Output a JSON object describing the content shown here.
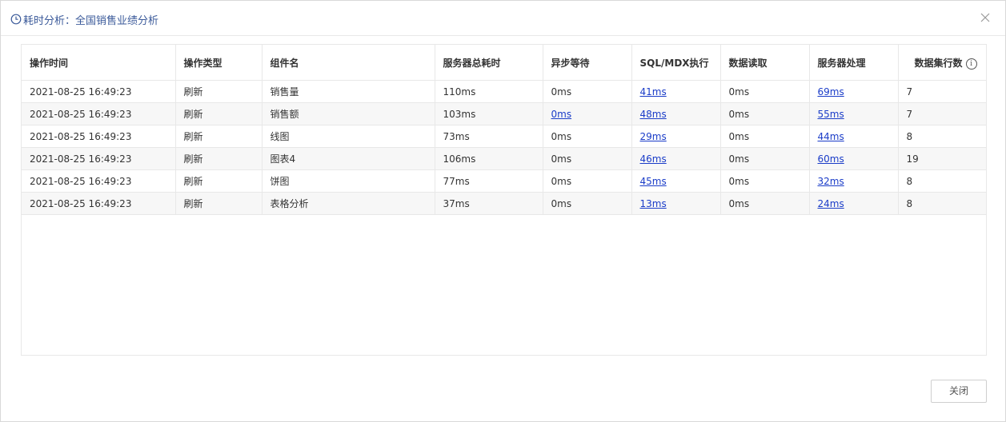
{
  "dialog": {
    "title": "耗时分析：全国销售业绩分析",
    "close_button_label": "关闭"
  },
  "table": {
    "columns": [
      "操作时间",
      "操作类型",
      "组件名",
      "服务器总耗时",
      "异步等待",
      "SQL/MDX执行",
      "数据读取",
      "服务器处理",
      "数据集行数"
    ],
    "rows": [
      {
        "time": "2021-08-25 16:49:23",
        "op": "刷新",
        "component": "销售量",
        "total": "110ms",
        "async": "0ms",
        "sql": "41ms",
        "read": "0ms",
        "server": "69ms",
        "rowcount": "7"
      },
      {
        "time": "2021-08-25 16:49:23",
        "op": "刷新",
        "component": "销售额",
        "total": "103ms",
        "async": "0ms",
        "sql": "48ms",
        "read": "0ms",
        "server": "55ms",
        "rowcount": "7"
      },
      {
        "time": "2021-08-25 16:49:23",
        "op": "刷新",
        "component": "线图",
        "total": "73ms",
        "async": "0ms",
        "sql": "29ms",
        "read": "0ms",
        "server": "44ms",
        "rowcount": "8"
      },
      {
        "time": "2021-08-25 16:49:23",
        "op": "刷新",
        "component": "图表4",
        "total": "106ms",
        "async": "0ms",
        "sql": "46ms",
        "read": "0ms",
        "server": "60ms",
        "rowcount": "19"
      },
      {
        "time": "2021-08-25 16:49:23",
        "op": "刷新",
        "component": "饼图",
        "total": "77ms",
        "async": "0ms",
        "sql": "45ms",
        "read": "0ms",
        "server": "32ms",
        "rowcount": "8"
      },
      {
        "time": "2021-08-25 16:49:23",
        "op": "刷新",
        "component": "表格分析",
        "total": "37ms",
        "async": "0ms",
        "sql": "13ms",
        "read": "0ms",
        "server": "24ms",
        "rowcount": "8"
      }
    ],
    "async_link_rows": [
      1
    ]
  },
  "icons": {
    "title_icon": "clock-icon",
    "close_icon": "close-icon",
    "info_icon": "info-icon"
  },
  "colors": {
    "title": "#3b5a9a",
    "link": "#1a3cc8",
    "border": "#e8e8e8"
  }
}
